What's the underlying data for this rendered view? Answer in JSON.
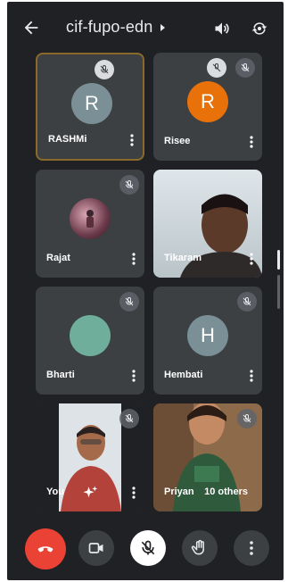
{
  "header": {
    "meeting_code": "cif-fupo-edn",
    "icons": [
      "back-arrow-icon",
      "caret-right-icon",
      "speaker-icon",
      "switch-camera-icon"
    ]
  },
  "participants": [
    {
      "name": "RASHMi",
      "initial": "R",
      "avatar_color": "#7a8f96",
      "muted": true,
      "active_speaker": true
    },
    {
      "name": "Risee",
      "initial": "R",
      "avatar_color": "#e8710a",
      "muted": true
    },
    {
      "name": "Rajat",
      "photo_avatar": true,
      "muted": true
    },
    {
      "name": "Tikaram",
      "video": true,
      "muted": false
    },
    {
      "name": "Bharti",
      "avatar_color": "#6fae9a",
      "muted": true
    },
    {
      "name": "Hembati",
      "initial": "H",
      "avatar_color": "#7a8f96",
      "muted": true
    },
    {
      "name": "You",
      "video": true,
      "muted": true
    },
    {
      "name": "Priyan",
      "others_label": "10 others",
      "video": true,
      "muted": true
    }
  ],
  "controls": {
    "items": [
      "end-call-icon",
      "camera-icon",
      "mic-off-icon",
      "raise-hand-icon",
      "more-options-icon"
    ],
    "colors": {
      "end_call": "#ea4335",
      "mic_active_bg": "#ffffff",
      "control_bg": "#3c4043"
    }
  }
}
